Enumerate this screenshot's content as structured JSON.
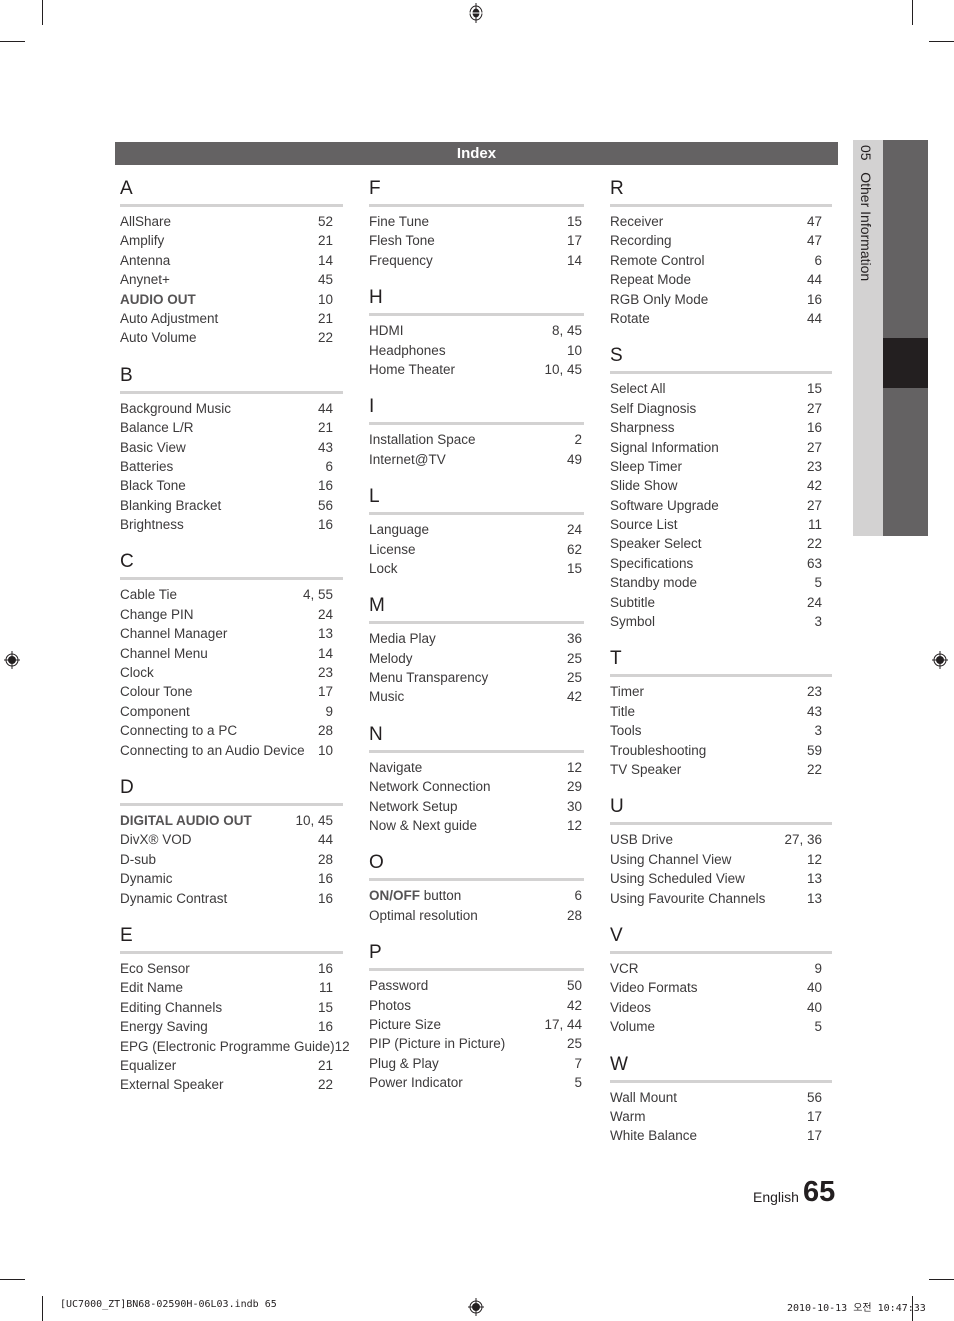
{
  "header": {
    "title": "Index"
  },
  "side_tab": {
    "label": "05   Other Information"
  },
  "columns": [
    [
      {
        "letter": "A",
        "entries": [
          {
            "term": "AllShare",
            "pages": "52"
          },
          {
            "term": "Amplify",
            "pages": "21"
          },
          {
            "term": "Antenna",
            "pages": "14"
          },
          {
            "term": "Anynet+",
            "pages": "45"
          },
          {
            "term": "AUDIO OUT",
            "pages": "10",
            "bold": true
          },
          {
            "term": "Auto Adjustment",
            "pages": "21"
          },
          {
            "term": "Auto Volume",
            "pages": "22"
          }
        ]
      },
      {
        "letter": "B",
        "entries": [
          {
            "term": "Background Music",
            "pages": "44"
          },
          {
            "term": "Balance L/R",
            "pages": "21"
          },
          {
            "term": "Basic View",
            "pages": "43"
          },
          {
            "term": "Batteries",
            "pages": "6"
          },
          {
            "term": "Black Tone",
            "pages": "16"
          },
          {
            "term": "Blanking Bracket",
            "pages": "56"
          },
          {
            "term": "Brightness",
            "pages": "16"
          }
        ]
      },
      {
        "letter": "C",
        "entries": [
          {
            "term": "Cable Tie",
            "pages": "4, 55"
          },
          {
            "term": "Change PIN",
            "pages": "24"
          },
          {
            "term": "Channel Manager",
            "pages": "13"
          },
          {
            "term": "Channel Menu",
            "pages": "14"
          },
          {
            "term": "Clock",
            "pages": "23"
          },
          {
            "term": "Colour Tone",
            "pages": "17"
          },
          {
            "term": "Component",
            "pages": "9"
          },
          {
            "term": "Connecting to a PC",
            "pages": "28"
          },
          {
            "term": "Connecting to an Audio Device",
            "pages": "10"
          }
        ]
      },
      {
        "letter": "D",
        "entries": [
          {
            "term": "DIGITAL AUDIO OUT",
            "pages": "10, 45",
            "bold": true
          },
          {
            "term": "DivX® VOD",
            "pages": "44"
          },
          {
            "term": "D-sub",
            "pages": "28"
          },
          {
            "term": "Dynamic",
            "pages": "16"
          },
          {
            "term": "Dynamic Contrast",
            "pages": "16"
          }
        ]
      },
      {
        "letter": "E",
        "entries": [
          {
            "term": "Eco Sensor",
            "pages": "16"
          },
          {
            "term": "Edit Name",
            "pages": "11"
          },
          {
            "term": "Editing Channels",
            "pages": "15"
          },
          {
            "term": "Energy Saving",
            "pages": "16"
          },
          {
            "term": "EPG (Electronic Programme Guide)",
            "pages": "12"
          },
          {
            "term": "Equalizer",
            "pages": "21"
          },
          {
            "term": "External Speaker",
            "pages": "22"
          }
        ]
      }
    ],
    [
      {
        "letter": "F",
        "entries": [
          {
            "term": "Fine Tune",
            "pages": "15"
          },
          {
            "term": "Flesh Tone",
            "pages": "17"
          },
          {
            "term": "Frequency",
            "pages": "14"
          }
        ]
      },
      {
        "letter": "H",
        "entries": [
          {
            "term": "HDMI",
            "pages": "8, 45"
          },
          {
            "term": "Headphones",
            "pages": "10"
          },
          {
            "term": "Home Theater",
            "pages": "10, 45"
          }
        ]
      },
      {
        "letter": "I",
        "entries": [
          {
            "term": "Installation Space",
            "pages": "2"
          },
          {
            "term": "Internet@TV",
            "pages": "49"
          }
        ]
      },
      {
        "letter": "L",
        "entries": [
          {
            "term": "Language",
            "pages": "24"
          },
          {
            "term": "License",
            "pages": "62"
          },
          {
            "term": "Lock",
            "pages": "15"
          }
        ]
      },
      {
        "letter": "M",
        "entries": [
          {
            "term": "Media Play",
            "pages": "36"
          },
          {
            "term": "Melody",
            "pages": "25"
          },
          {
            "term": "Menu Transparency",
            "pages": "25"
          },
          {
            "term": "Music",
            "pages": "42"
          }
        ]
      },
      {
        "letter": "N",
        "entries": [
          {
            "term": "Navigate",
            "pages": "12"
          },
          {
            "term": "Network Connection",
            "pages": "29"
          },
          {
            "term": "Network Setup",
            "pages": "30"
          },
          {
            "term": "Now & Next guide",
            "pages": "12"
          }
        ]
      },
      {
        "letter": "O",
        "entries": [
          {
            "term": "ON/OFF",
            "term_suffix": " button",
            "pages": "6",
            "bold": true
          },
          {
            "term": "Optimal resolution",
            "pages": "28"
          }
        ]
      },
      {
        "letter": "P",
        "entries": [
          {
            "term": "Password",
            "pages": "50"
          },
          {
            "term": "Photos",
            "pages": "42"
          },
          {
            "term": "Picture Size",
            "pages": "17, 44"
          },
          {
            "term": "PIP (Picture in Picture)",
            "pages": "25"
          },
          {
            "term": "Plug & Play",
            "pages": "7"
          },
          {
            "term": "Power Indicator",
            "pages": "5"
          }
        ]
      }
    ],
    [
      {
        "letter": "R",
        "entries": [
          {
            "term": "Receiver",
            "pages": "47"
          },
          {
            "term": "Recording",
            "pages": "47"
          },
          {
            "term": "Remote Control",
            "pages": "6"
          },
          {
            "term": "Repeat Mode",
            "pages": "44"
          },
          {
            "term": "RGB Only Mode",
            "pages": "16"
          },
          {
            "term": "Rotate",
            "pages": "44"
          }
        ]
      },
      {
        "letter": "S",
        "entries": [
          {
            "term": "Select All",
            "pages": "15"
          },
          {
            "term": "Self Diagnosis",
            "pages": "27"
          },
          {
            "term": "Sharpness",
            "pages": "16"
          },
          {
            "term": "Signal Information",
            "pages": "27"
          },
          {
            "term": "Sleep Timer",
            "pages": "23"
          },
          {
            "term": "Slide Show",
            "pages": "42"
          },
          {
            "term": "Software Upgrade",
            "pages": "27"
          },
          {
            "term": "Source List",
            "pages": "11"
          },
          {
            "term": "Speaker Select",
            "pages": "22"
          },
          {
            "term": "Specifications",
            "pages": "63"
          },
          {
            "term": "Standby mode",
            "pages": "5"
          },
          {
            "term": "Subtitle",
            "pages": "24"
          },
          {
            "term": "Symbol",
            "pages": "3"
          }
        ]
      },
      {
        "letter": "T",
        "entries": [
          {
            "term": "Timer",
            "pages": "23"
          },
          {
            "term": "Title",
            "pages": "43"
          },
          {
            "term": "Tools",
            "pages": "3"
          },
          {
            "term": "Troubleshooting",
            "pages": "59"
          },
          {
            "term": "TV Speaker",
            "pages": "22"
          }
        ]
      },
      {
        "letter": "U",
        "entries": [
          {
            "term": "USB Drive",
            "pages": "27, 36"
          },
          {
            "term": "Using Channel View",
            "pages": "12"
          },
          {
            "term": "Using Scheduled View",
            "pages": "13"
          },
          {
            "term": "Using Favourite Channels",
            "pages": "13"
          }
        ]
      },
      {
        "letter": "V",
        "entries": [
          {
            "term": "VCR",
            "pages": "9"
          },
          {
            "term": "Video Formats",
            "pages": "40"
          },
          {
            "term": "Videos",
            "pages": "40"
          },
          {
            "term": "Volume",
            "pages": "5"
          }
        ]
      },
      {
        "letter": "W",
        "entries": [
          {
            "term": "Wall Mount",
            "pages": "56"
          },
          {
            "term": "Warm",
            "pages": "17"
          },
          {
            "term": "White Balance",
            "pages": "17"
          }
        ]
      }
    ]
  ],
  "footer": {
    "language": "English",
    "page_number": "65"
  },
  "print_slug": {
    "left": "[UC7000_ZT]BN68-02590H-06L03.indb   65",
    "right": "2010-10-13   오전 10:47:33"
  }
}
